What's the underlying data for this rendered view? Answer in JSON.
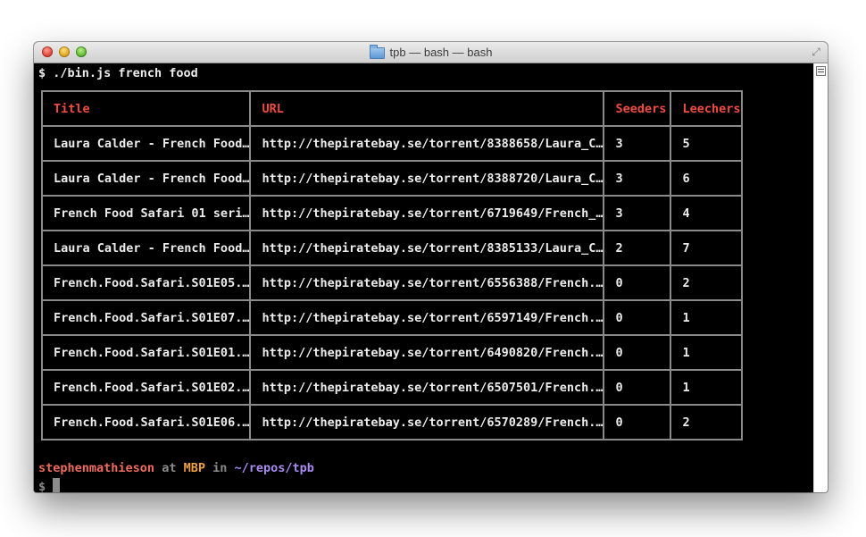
{
  "window": {
    "title": "tpb — bash — bash"
  },
  "terminal": {
    "command": "$ ./bin.js french food",
    "table": {
      "headers": [
        "Title",
        "URL",
        "Seeders",
        "Leechers"
      ],
      "rows": [
        [
          "Laura Calder - French Food…",
          "http://thepiratebay.se/torrent/8388658/Laura_C…",
          "3",
          "5"
        ],
        [
          "Laura Calder - French Food…",
          "http://thepiratebay.se/torrent/8388720/Laura_C…",
          "3",
          "6"
        ],
        [
          "French Food Safari 01 seri…",
          "http://thepiratebay.se/torrent/6719649/French_…",
          "3",
          "4"
        ],
        [
          "Laura Calder - French Food…",
          "http://thepiratebay.se/torrent/8385133/Laura_C…",
          "2",
          "7"
        ],
        [
          "French.Food.Safari.S01E05.…",
          "http://thepiratebay.se/torrent/6556388/French.…",
          "0",
          "2"
        ],
        [
          "French.Food.Safari.S01E07.…",
          "http://thepiratebay.se/torrent/6597149/French.…",
          "0",
          "1"
        ],
        [
          "French.Food.Safari.S01E01.…",
          "http://thepiratebay.se/torrent/6490820/French.…",
          "0",
          "1"
        ],
        [
          "French.Food.Safari.S01E02.…",
          "http://thepiratebay.se/torrent/6507501/French.…",
          "0",
          "1"
        ],
        [
          "French.Food.Safari.S01E06.…",
          "http://thepiratebay.se/torrent/6570289/French.…",
          "0",
          "2"
        ]
      ]
    },
    "prompt": {
      "user": "stephenmathieson",
      "at": "at",
      "host": "MBP",
      "in": "in",
      "path": "~/repos/tpb",
      "symbol": "$"
    }
  },
  "colors": {
    "header": "#f14b42",
    "user": "#f06b5f",
    "host": "#f0a23c",
    "path": "#a98bf0",
    "text": "#ececec",
    "border": "#8a8a8a"
  },
  "icons": {
    "folder": "folder-icon",
    "fullscreen": "fullscreen-icon"
  }
}
